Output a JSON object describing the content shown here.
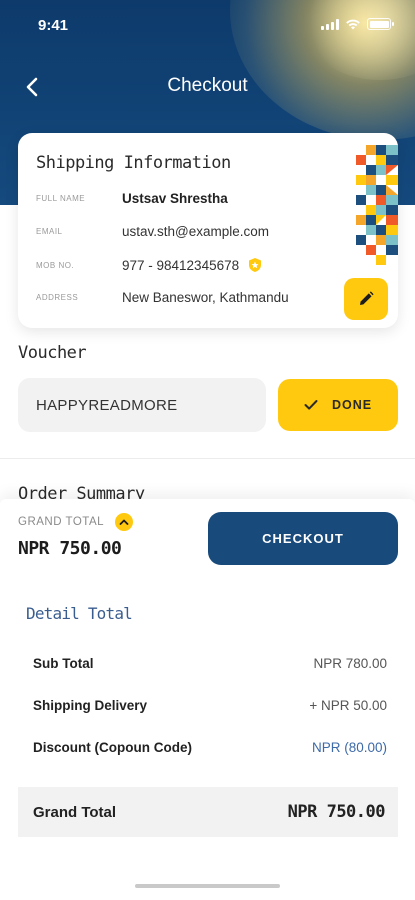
{
  "status_bar": {
    "time": "9:41"
  },
  "header": {
    "title": "Checkout"
  },
  "shipping": {
    "title": "Shipping Information",
    "rows": [
      {
        "label": "FULL NAME",
        "value": "Ustsav Shrestha"
      },
      {
        "label": "EMAIL",
        "value": "ustav.sth@example.com"
      },
      {
        "label": "MOB NO.",
        "value": "977 - 98412345678"
      },
      {
        "label": "ADDRESS",
        "value": "New Baneswor, Kathmandu"
      }
    ]
  },
  "voucher": {
    "label": "Voucher",
    "code": "HAPPYREADMORE",
    "done_label": "DONE"
  },
  "order_summary": {
    "label": "Order Summary"
  },
  "grand_total_bar": {
    "label": "GRAND TOTAL",
    "value": "NPR 750.00",
    "checkout_label": "CHECKOUT"
  },
  "detail": {
    "title": "Detail Total",
    "rows": [
      {
        "label": "Sub Total",
        "value": "NPR 780.00"
      },
      {
        "label": "Shipping Delivery",
        "value": "+ NPR 50.00"
      },
      {
        "label": "Discount (Copoun Code)",
        "value": "NPR (80.00)"
      }
    ],
    "grand_label": "Grand Total",
    "grand_value": "NPR 750.00"
  },
  "colors": {
    "primary": "#184a7c",
    "accent": "#ffc90f",
    "discount": "#3d6aa8"
  },
  "icons": [
    "chevron-left-icon",
    "verified-shield-icon",
    "pencil-icon",
    "check-icon",
    "chevron-up-icon",
    "wifi-icon",
    "battery-icon",
    "signal-icon"
  ]
}
